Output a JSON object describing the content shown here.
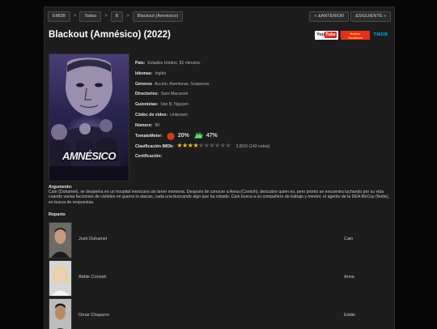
{
  "breadcrumb": [
    "EMDB",
    "Todas",
    "B",
    "Blackout (Amnésico)"
  ],
  "separator": ">",
  "nav": {
    "prev": "« &ANTERIOR",
    "next": "&SIGUIENTE »"
  },
  "title": "Blackout (Amnésico) (2022)",
  "logos": {
    "youtube_you": "You",
    "youtube_tube": "Tube",
    "rt_line1": "Rotten",
    "rt_line2": "Tomatoes",
    "tmdb": "TMDB"
  },
  "poster": {
    "title_text": "AMNÉSICO"
  },
  "info": [
    {
      "label": "País:",
      "value": "Estados Unidos, 81 minutos."
    },
    {
      "label": "Idiomas:",
      "value": "Inglés"
    },
    {
      "label": "Géneros",
      "value": "Acción, Aventuras, Suspenso"
    },
    {
      "label": "Director/es:",
      "value": "Sam Macaroni"
    },
    {
      "label": "Guionistas:",
      "value": "Van B. Nguyen"
    },
    {
      "label": "Códec de vídeo:",
      "value": "Unknown"
    },
    {
      "label": "Número:",
      "value": "90"
    }
  ],
  "tomatometer": {
    "label": "TomatoMeter:",
    "critics": "20%",
    "audience": "47%",
    "critics_icon": "tomato-icon",
    "audience_icon": "splat-icon",
    "critics_color": "#d63a1b",
    "audience_color": "#27a046"
  },
  "imdb": {
    "label": "Clasificación IMDb:",
    "rating": 3.8,
    "stars_total": 10,
    "text": "3.8/10 (142 votos)"
  },
  "certification": {
    "label": "Certificación:"
  },
  "plot": {
    "label": "Argumento:",
    "text": "Cain (Duhamel), se despierta en un hospital mexicano sin tener memoria. Después de conocer a Anna (Cornish), descubre quién es, pero pronto se encuentra luchando por su vida cuando varias facciones de cárteles en guerra lo atacan, cada una buscando algo que ha robado. Cain busca a su compañero de trabajo y mentor, el agente de la DEA McCoy (Nolte), en busca de respuestas."
  },
  "cast": {
    "title": "Reparto",
    "members": [
      {
        "name": "Josh Duhamel",
        "character": "Cain"
      },
      {
        "name": "Abbie Cornish",
        "character": "Anna"
      },
      {
        "name": "Omar Chaparro",
        "character": "Eddie"
      }
    ]
  }
}
